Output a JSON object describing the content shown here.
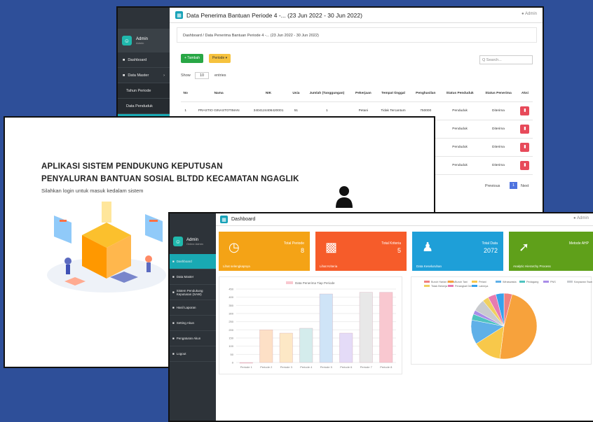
{
  "w1": {
    "title": "Data Penerima Bantuan Periode 4 -... (23 Jun 2022 - 30 Jun 2022)",
    "admin": "Admin",
    "breadcrumb": "Dashboard / Data Penerima Bantuan Periode 4 -... (23 Jun 2022 - 30 Jun 2022)",
    "user": {
      "name": "Admin",
      "role": "Admin"
    },
    "nav": [
      {
        "label": "Dashboard"
      },
      {
        "label": "Data Master"
      },
      {
        "label": "Tahun Periode"
      },
      {
        "label": "Data Penduduk"
      },
      {
        "label": "..."
      }
    ],
    "btn_tambah": "+ Tambah",
    "btn_periode": "Periode ▾",
    "search_placeholder": "Q Search...",
    "show": "Show",
    "show_value": "10",
    "entries": "entries",
    "headers": [
      "No",
      "Nama",
      "NIK",
      "Usia",
      "Jumlah (Tanggungan)",
      "Pekerjaan",
      "Tempat tinggal",
      "Penghasilan",
      "Status Penduduk",
      "Status Penerima",
      "Aksi"
    ],
    "rows": [
      [
        "1",
        "PRASTIO GINASTOTIMAN",
        "3404124406420001",
        "51",
        "1",
        "Petani",
        "Tidak Tercantum",
        "750000",
        "Penduduk",
        "Diterima",
        "▮"
      ],
      [
        "",
        "",
        "",
        "",
        "",
        "",
        "",
        "",
        "Penduduk",
        "Diterima",
        "▮"
      ],
      [
        "",
        "",
        "",
        "",
        "",
        "",
        "",
        "",
        "Penduduk",
        "Diterima",
        "▮"
      ],
      [
        "",
        "",
        "",
        "",
        "",
        "",
        "",
        "",
        "Penduduk",
        "Diterima",
        "▮"
      ]
    ],
    "previous": "Previous",
    "page": "1",
    "next": "Next"
  },
  "w2": {
    "title1": "APLIKASI SISTEM PENDUKUNG KEPUTUSAN",
    "title2": "PENYALURAN BANTUAN SOSIAL BLTDD KECAMATAN NGAGLIK",
    "subtitle": "Silahkan login untuk masuk kedalam sistem"
  },
  "w3": {
    "title": "Dashboard",
    "admin": "Admin",
    "user": {
      "name": "Admin",
      "role": "Online Admin"
    },
    "nav": [
      {
        "label": "Dashboard"
      },
      {
        "label": "Data Master"
      },
      {
        "label": "Sistem Pendukung Keputusan (SAW)"
      },
      {
        "label": "Hasil Laporan"
      },
      {
        "label": "Setting Akun"
      },
      {
        "label": "Pengaturan Akun"
      },
      {
        "label": "Logout"
      }
    ],
    "cards": [
      {
        "label": "Total Periode",
        "num": "8",
        "foot": "Lihat selengkapnya",
        "color": "#f4a316",
        "icon": "clock-icon"
      },
      {
        "label": "Total Kriteria",
        "num": "5",
        "foot": "Lihat Kriteria",
        "color": "#f65c2a",
        "icon": "chart-icon"
      },
      {
        "label": "Total Data",
        "num": "2072",
        "foot": "Data Keseluruhan",
        "color": "#1e9fd8",
        "icon": "users-icon"
      },
      {
        "label": "Metode AHP",
        "num": "",
        "foot": "Analytic Hierarchy Process",
        "color": "#5fa01a",
        "icon": "trend-icon"
      }
    ]
  },
  "chart_data": [
    {
      "type": "bar",
      "legend": [
        "Data Penerima Tiap Periode"
      ],
      "categories": [
        "Periode 1",
        "Periode 2",
        "Periode 3",
        "Periode 4",
        "Periode 5",
        "Periode 6",
        "Periode 7",
        "Periode 8"
      ],
      "values": [
        0,
        200,
        180,
        210,
        420,
        180,
        430,
        430
      ],
      "ylim": [
        0,
        450
      ],
      "colors": [
        "#f9c8d0",
        "#fde0c6",
        "#fde8c6",
        "#d4ecec",
        "#cfe4f7",
        "#e4dbf7",
        "#e8e8e8",
        "#f9c8d0"
      ],
      "yticks": [
        "0",
        "50",
        "100",
        "150",
        "200",
        "250",
        "300",
        "350",
        "400",
        "450"
      ]
    },
    {
      "type": "pie",
      "legend": [
        "Buruh Harian Lepas",
        "Buruh Tani",
        "Petani",
        "Wiraswasta",
        "Pedagang",
        "PNS",
        "Karyawan Swasta",
        "Tidak Bekerja",
        "Perangkat Desa",
        "Lainnya"
      ],
      "colors": [
        "#f08080",
        "#f7a23c",
        "#f8c84a",
        "#5fb0e8",
        "#4fc3c0",
        "#a98de8",
        "#c9cbcf",
        "#f0d060",
        "#e77bb0",
        "#36a2eb"
      ],
      "values": [
        4,
        48,
        14,
        12,
        3,
        2,
        6,
        3,
        4,
        4
      ]
    }
  ]
}
